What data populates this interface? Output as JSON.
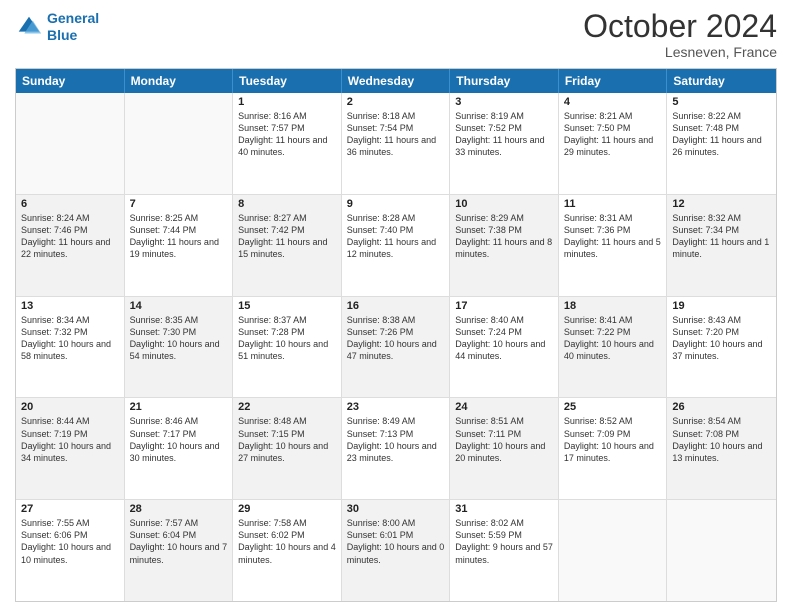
{
  "header": {
    "logo_line1": "General",
    "logo_line2": "Blue",
    "month_title": "October 2024",
    "location": "Lesneven, France"
  },
  "days_of_week": [
    "Sunday",
    "Monday",
    "Tuesday",
    "Wednesday",
    "Thursday",
    "Friday",
    "Saturday"
  ],
  "rows": [
    [
      {
        "day": "",
        "sunrise": "",
        "sunset": "",
        "daylight": "",
        "empty": true
      },
      {
        "day": "",
        "sunrise": "",
        "sunset": "",
        "daylight": "",
        "empty": true
      },
      {
        "day": "1",
        "sunrise": "Sunrise: 8:16 AM",
        "sunset": "Sunset: 7:57 PM",
        "daylight": "Daylight: 11 hours and 40 minutes."
      },
      {
        "day": "2",
        "sunrise": "Sunrise: 8:18 AM",
        "sunset": "Sunset: 7:54 PM",
        "daylight": "Daylight: 11 hours and 36 minutes."
      },
      {
        "day": "3",
        "sunrise": "Sunrise: 8:19 AM",
        "sunset": "Sunset: 7:52 PM",
        "daylight": "Daylight: 11 hours and 33 minutes."
      },
      {
        "day": "4",
        "sunrise": "Sunrise: 8:21 AM",
        "sunset": "Sunset: 7:50 PM",
        "daylight": "Daylight: 11 hours and 29 minutes."
      },
      {
        "day": "5",
        "sunrise": "Sunrise: 8:22 AM",
        "sunset": "Sunset: 7:48 PM",
        "daylight": "Daylight: 11 hours and 26 minutes."
      }
    ],
    [
      {
        "day": "6",
        "sunrise": "Sunrise: 8:24 AM",
        "sunset": "Sunset: 7:46 PM",
        "daylight": "Daylight: 11 hours and 22 minutes.",
        "shaded": true
      },
      {
        "day": "7",
        "sunrise": "Sunrise: 8:25 AM",
        "sunset": "Sunset: 7:44 PM",
        "daylight": "Daylight: 11 hours and 19 minutes."
      },
      {
        "day": "8",
        "sunrise": "Sunrise: 8:27 AM",
        "sunset": "Sunset: 7:42 PM",
        "daylight": "Daylight: 11 hours and 15 minutes.",
        "shaded": true
      },
      {
        "day": "9",
        "sunrise": "Sunrise: 8:28 AM",
        "sunset": "Sunset: 7:40 PM",
        "daylight": "Daylight: 11 hours and 12 minutes."
      },
      {
        "day": "10",
        "sunrise": "Sunrise: 8:29 AM",
        "sunset": "Sunset: 7:38 PM",
        "daylight": "Daylight: 11 hours and 8 minutes.",
        "shaded": true
      },
      {
        "day": "11",
        "sunrise": "Sunrise: 8:31 AM",
        "sunset": "Sunset: 7:36 PM",
        "daylight": "Daylight: 11 hours and 5 minutes."
      },
      {
        "day": "12",
        "sunrise": "Sunrise: 8:32 AM",
        "sunset": "Sunset: 7:34 PM",
        "daylight": "Daylight: 11 hours and 1 minute.",
        "shaded": true
      }
    ],
    [
      {
        "day": "13",
        "sunrise": "Sunrise: 8:34 AM",
        "sunset": "Sunset: 7:32 PM",
        "daylight": "Daylight: 10 hours and 58 minutes."
      },
      {
        "day": "14",
        "sunrise": "Sunrise: 8:35 AM",
        "sunset": "Sunset: 7:30 PM",
        "daylight": "Daylight: 10 hours and 54 minutes.",
        "shaded": true
      },
      {
        "day": "15",
        "sunrise": "Sunrise: 8:37 AM",
        "sunset": "Sunset: 7:28 PM",
        "daylight": "Daylight: 10 hours and 51 minutes."
      },
      {
        "day": "16",
        "sunrise": "Sunrise: 8:38 AM",
        "sunset": "Sunset: 7:26 PM",
        "daylight": "Daylight: 10 hours and 47 minutes.",
        "shaded": true
      },
      {
        "day": "17",
        "sunrise": "Sunrise: 8:40 AM",
        "sunset": "Sunset: 7:24 PM",
        "daylight": "Daylight: 10 hours and 44 minutes."
      },
      {
        "day": "18",
        "sunrise": "Sunrise: 8:41 AM",
        "sunset": "Sunset: 7:22 PM",
        "daylight": "Daylight: 10 hours and 40 minutes.",
        "shaded": true
      },
      {
        "day": "19",
        "sunrise": "Sunrise: 8:43 AM",
        "sunset": "Sunset: 7:20 PM",
        "daylight": "Daylight: 10 hours and 37 minutes."
      }
    ],
    [
      {
        "day": "20",
        "sunrise": "Sunrise: 8:44 AM",
        "sunset": "Sunset: 7:19 PM",
        "daylight": "Daylight: 10 hours and 34 minutes.",
        "shaded": true
      },
      {
        "day": "21",
        "sunrise": "Sunrise: 8:46 AM",
        "sunset": "Sunset: 7:17 PM",
        "daylight": "Daylight: 10 hours and 30 minutes."
      },
      {
        "day": "22",
        "sunrise": "Sunrise: 8:48 AM",
        "sunset": "Sunset: 7:15 PM",
        "daylight": "Daylight: 10 hours and 27 minutes.",
        "shaded": true
      },
      {
        "day": "23",
        "sunrise": "Sunrise: 8:49 AM",
        "sunset": "Sunset: 7:13 PM",
        "daylight": "Daylight: 10 hours and 23 minutes."
      },
      {
        "day": "24",
        "sunrise": "Sunrise: 8:51 AM",
        "sunset": "Sunset: 7:11 PM",
        "daylight": "Daylight: 10 hours and 20 minutes.",
        "shaded": true
      },
      {
        "day": "25",
        "sunrise": "Sunrise: 8:52 AM",
        "sunset": "Sunset: 7:09 PM",
        "daylight": "Daylight: 10 hours and 17 minutes."
      },
      {
        "day": "26",
        "sunrise": "Sunrise: 8:54 AM",
        "sunset": "Sunset: 7:08 PM",
        "daylight": "Daylight: 10 hours and 13 minutes.",
        "shaded": true
      }
    ],
    [
      {
        "day": "27",
        "sunrise": "Sunrise: 7:55 AM",
        "sunset": "Sunset: 6:06 PM",
        "daylight": "Daylight: 10 hours and 10 minutes."
      },
      {
        "day": "28",
        "sunrise": "Sunrise: 7:57 AM",
        "sunset": "Sunset: 6:04 PM",
        "daylight": "Daylight: 10 hours and 7 minutes.",
        "shaded": true
      },
      {
        "day": "29",
        "sunrise": "Sunrise: 7:58 AM",
        "sunset": "Sunset: 6:02 PM",
        "daylight": "Daylight: 10 hours and 4 minutes."
      },
      {
        "day": "30",
        "sunrise": "Sunrise: 8:00 AM",
        "sunset": "Sunset: 6:01 PM",
        "daylight": "Daylight: 10 hours and 0 minutes.",
        "shaded": true
      },
      {
        "day": "31",
        "sunrise": "Sunrise: 8:02 AM",
        "sunset": "Sunset: 5:59 PM",
        "daylight": "Daylight: 9 hours and 57 minutes."
      },
      {
        "day": "",
        "sunrise": "",
        "sunset": "",
        "daylight": "",
        "empty": true,
        "shaded": true
      },
      {
        "day": "",
        "sunrise": "",
        "sunset": "",
        "daylight": "",
        "empty": true
      }
    ]
  ]
}
